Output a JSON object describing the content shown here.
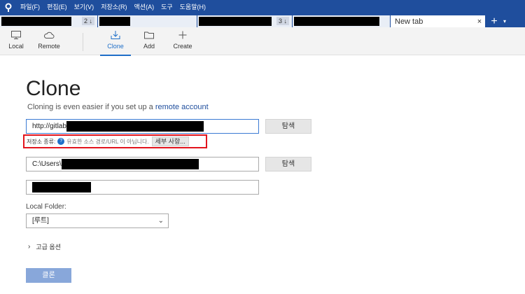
{
  "menu": {
    "items": [
      "파일(F)",
      "편집(E)",
      "보기(V)",
      "저장소(R)",
      "액션(A)",
      "도구",
      "도움말(H)"
    ]
  },
  "tabs": [
    {
      "badge": "2 ↓"
    },
    {
      "badge": ""
    },
    {
      "badge": "3 ↓"
    },
    {
      "badge": ""
    }
  ],
  "active_tab": {
    "title": "New tab",
    "close": "×"
  },
  "tabbar": {
    "plus": "+",
    "caret": "▾"
  },
  "toolbar": {
    "local": "Local",
    "remote": "Remote",
    "clone": "Clone",
    "add": "Add",
    "create": "Create"
  },
  "page": {
    "title": "Clone",
    "subtitle_prefix": "Cloning is even easier if you set up a ",
    "subtitle_link": "remote account"
  },
  "source": {
    "value": "http://gitlab",
    "browse": "탐색"
  },
  "repo_type": {
    "label": "저장소 종류:",
    "help": "?",
    "message": "유효한 소스 경로/URL 이 아닙니다.",
    "details": "세부 사항..."
  },
  "destination": {
    "value": "C:\\Users\\",
    "browse": "탐색"
  },
  "local_folder": {
    "label": "Local Folder:",
    "value": "[루트]",
    "chevron": "⌄"
  },
  "advanced": {
    "chevron": "›",
    "label": "고급 옵션"
  },
  "clone_button": "클론"
}
